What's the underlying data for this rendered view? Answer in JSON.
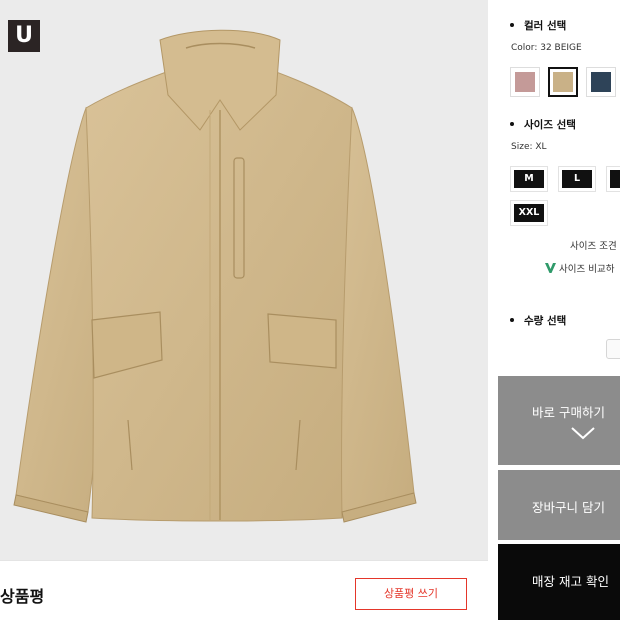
{
  "brand": {
    "badge": "U"
  },
  "product": {
    "image_alt": "beige jacket",
    "color_hex": "#d2b98c"
  },
  "reviews": {
    "title": "상품평",
    "write_button": "상품평 쓰기"
  },
  "color_section": {
    "title": "컬러 선택",
    "selected_label": "Color: 32 BEIGE",
    "swatches": [
      {
        "name": "pink",
        "hex": "#c49a98",
        "selected": false
      },
      {
        "name": "beige",
        "hex": "#c9b187",
        "selected": true
      },
      {
        "name": "navy",
        "hex": "#2e4358",
        "selected": false
      }
    ]
  },
  "size_section": {
    "title": "사이즈 선택",
    "selected_label": "Size: XL",
    "sizes": [
      "M",
      "L",
      "X",
      "XXL"
    ],
    "guide_link": "사이즈 조견",
    "compare_link": "사이즈 비교하"
  },
  "quantity_section": {
    "title": "수량 선택"
  },
  "actions": {
    "buy_now": "바로 구매하기",
    "add_to_cart": "장바구니 담기",
    "store_stock": "매장 재고 확인"
  },
  "colors": {
    "accent_red": "#e4362a",
    "action_gray": "#8c8c8c",
    "action_black": "#0a0a0a",
    "check_green": "#2f9a6a"
  }
}
